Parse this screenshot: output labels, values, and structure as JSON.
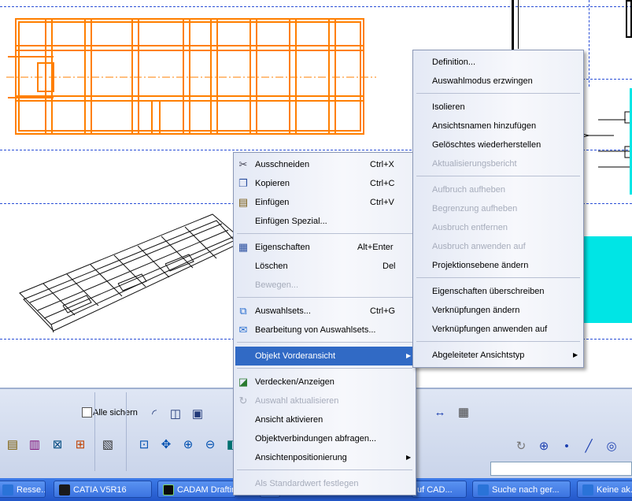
{
  "main_menu": {
    "items": [
      {
        "label": "Ausschneiden",
        "shortcut": "Ctrl+X",
        "icon": "scissors-icon",
        "enabled": true
      },
      {
        "label": "Kopieren",
        "shortcut": "Ctrl+C",
        "icon": "copy-icon",
        "enabled": true
      },
      {
        "label": "Einfügen",
        "shortcut": "Ctrl+V",
        "icon": "paste-icon",
        "enabled": true
      },
      {
        "label": "Einfügen Spezial...",
        "shortcut": "",
        "enabled": true
      },
      {
        "label": "Eigenschaften",
        "shortcut": "Alt+Enter",
        "icon": "properties-icon",
        "enabled": true
      },
      {
        "label": "Löschen",
        "shortcut": "Del",
        "enabled": true
      },
      {
        "label": "Bewegen...",
        "shortcut": "",
        "enabled": false
      },
      {
        "label": "Auswahlsets...",
        "shortcut": "Ctrl+G",
        "icon": "selection-sets-icon",
        "enabled": true
      },
      {
        "label": "Bearbeitung von Auswahlsets...",
        "shortcut": "",
        "icon": "edit-selection-sets-icon",
        "enabled": true
      },
      {
        "label": "Objekt Vorderansicht",
        "shortcut": "",
        "submenu": true,
        "highlighted": true,
        "enabled": true
      },
      {
        "label": "Verdecken/Anzeigen",
        "shortcut": "",
        "icon": "hide-show-icon",
        "enabled": true
      },
      {
        "label": "Auswahl aktualisieren",
        "shortcut": "",
        "icon": "update-icon",
        "enabled": false
      },
      {
        "label": "Ansicht aktivieren",
        "shortcut": "",
        "enabled": true
      },
      {
        "label": "Objektverbindungen abfragen...",
        "shortcut": "",
        "enabled": true
      },
      {
        "label": "Ansichtenpositionierung",
        "shortcut": "",
        "submenu": true,
        "enabled": true
      },
      {
        "label": "Als Standardwert festlegen",
        "shortcut": "",
        "enabled": false
      }
    ]
  },
  "sub_menu": {
    "items": [
      {
        "label": "Definition...",
        "enabled": true
      },
      {
        "label": "Auswahlmodus erzwingen",
        "enabled": true
      },
      {
        "label": "Isolieren",
        "enabled": true
      },
      {
        "label": "Ansichtsnamen hinzufügen",
        "enabled": true
      },
      {
        "label": "Gelöschtes wiederherstellen",
        "enabled": true
      },
      {
        "label": "Aktualisierungsbericht",
        "enabled": false
      },
      {
        "label": "Aufbruch aufheben",
        "enabled": false
      },
      {
        "label": "Begrenzung aufheben",
        "enabled": false
      },
      {
        "label": "Ausbruch entfernen",
        "enabled": false
      },
      {
        "label": "Ausbruch anwenden auf",
        "enabled": false
      },
      {
        "label": "Projektionsebene ändern",
        "enabled": true
      },
      {
        "label": "Eigenschaften überschreiben",
        "enabled": true
      },
      {
        "label": "Verknüpfungen ändern",
        "enabled": true
      },
      {
        "label": "Verknüpfungen anwenden auf",
        "enabled": true
      },
      {
        "label": "Abgeleiteter Ansichtstyp",
        "enabled": true,
        "submenu": true
      }
    ]
  },
  "toolbar": {
    "save_all_label": "Alle sichern"
  },
  "taskbar": {
    "items": [
      {
        "label": "Resse...",
        "icon": "ie-icon"
      },
      {
        "label": "CATIA V5R16",
        "icon": "catia-icon"
      },
      {
        "label": "CADAM Drafting",
        "icon": "console-icon"
      },
      {
        "label": "",
        "icon": "window-icon"
      },
      {
        "label": "uf CAD...",
        "icon": "ie-icon"
      },
      {
        "label": "Suche nach ger...",
        "icon": "ie-icon"
      },
      {
        "label": "Keine ak...",
        "icon": "ie-icon"
      }
    ]
  },
  "colors": {
    "selection": "#316ac5",
    "orange_part": "#ff7f00",
    "dash_lines": "#2a4fd6",
    "cyan_part": "#00e5e5"
  }
}
